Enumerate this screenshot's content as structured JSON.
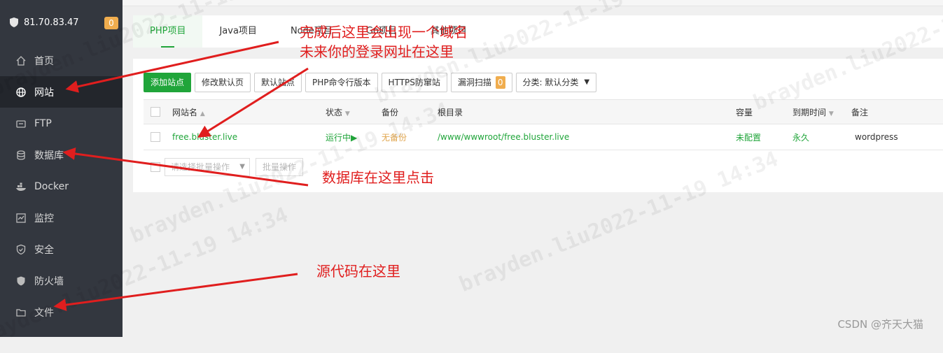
{
  "sidebar": {
    "ip": "81.70.83.47",
    "badge": "0",
    "items": [
      {
        "label": "首页",
        "icon": "home-icon"
      },
      {
        "label": "网站",
        "icon": "globe-icon"
      },
      {
        "label": "FTP",
        "icon": "ftp-icon"
      },
      {
        "label": "数据库",
        "icon": "database-icon"
      },
      {
        "label": "Docker",
        "icon": "docker-icon"
      },
      {
        "label": "监控",
        "icon": "monitor-icon"
      },
      {
        "label": "安全",
        "icon": "security-icon"
      },
      {
        "label": "防火墙",
        "icon": "firewall-icon"
      },
      {
        "label": "文件",
        "icon": "folder-icon"
      }
    ]
  },
  "tabs": [
    "PHP项目",
    "Java项目",
    "Node项目",
    "Go项目",
    "其他项目"
  ],
  "toolbar": {
    "add_site": "添加站点",
    "edit_default_page": "修改默认页",
    "default_site": "默认站点",
    "php_cli": "PHP命令行版本",
    "https_guard": "HTTPS防窜站",
    "vuln_scan": "漏洞扫描",
    "vuln_count": "0",
    "category": "分类: 默认分类"
  },
  "table": {
    "headers": {
      "name": "网站名",
      "status": "状态",
      "backup": "备份",
      "root": "根目录",
      "capacity": "容量",
      "expire": "到期时间",
      "remark": "备注"
    },
    "rows": [
      {
        "name": "free.bluster.live",
        "status": "运行中▶",
        "backup": "无备份",
        "root": "/www/wwwroot/free.bluster.live",
        "capacity": "未配置",
        "expire": "永久",
        "remark": "wordpress"
      }
    ]
  },
  "batch": {
    "select_placeholder": "请选择批量操作",
    "button": "批量操作"
  },
  "annotations": {
    "domain_line1": "完成后这里会出现一个域名",
    "domain_line2": "未来你的登录网址在这里",
    "database": "数据库在这里点击",
    "source": "源代码在这里"
  },
  "watermark": "brayden.liu2022-11-19 14:34",
  "credit": "CSDN @齐天大猫",
  "colors": {
    "sidebar_bg": "#33373f",
    "accent": "#20a53a",
    "annotation": "#e01e1e",
    "warn": "#f0ad4e"
  }
}
